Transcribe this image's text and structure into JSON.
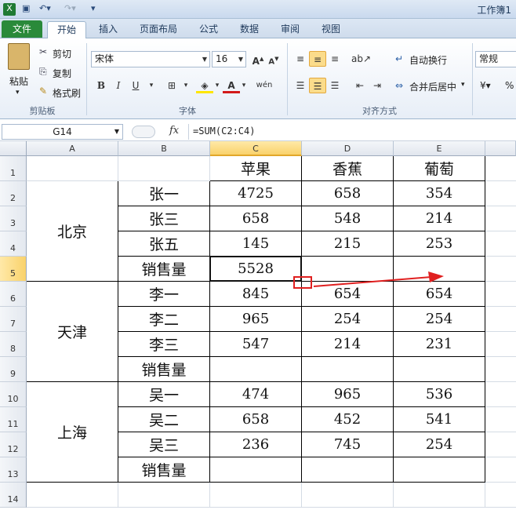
{
  "window": {
    "title": "工作簿1"
  },
  "ribbon": {
    "tabs": [
      "文件",
      "开始",
      "插入",
      "页面布局",
      "公式",
      "数据",
      "审阅",
      "视图"
    ],
    "clipboard": {
      "paste": "粘贴",
      "cut": "剪切",
      "copy": "复制",
      "format_painter": "格式刷",
      "label": "剪贴板"
    },
    "font": {
      "name": "宋体",
      "size": "16",
      "bold": "B",
      "italic": "I",
      "underline": "U",
      "label": "字体"
    },
    "alignment": {
      "wrap": "自动换行",
      "merge": "合并后居中",
      "label": "对齐方式"
    },
    "number": {
      "format": "常规",
      "percent": "%"
    }
  },
  "formula_bar": {
    "name_box": "G14",
    "fx": "fx",
    "formula": "=SUM(C2:C4)"
  },
  "columns": [
    "A",
    "B",
    "C",
    "D",
    "E"
  ],
  "rows": [
    "1",
    "2",
    "3",
    "4",
    "5",
    "6",
    "7",
    "8",
    "9",
    "10",
    "11",
    "12",
    "13",
    "14"
  ],
  "table": {
    "headers": [
      "苹果",
      "香蕉",
      "葡萄"
    ],
    "groups": [
      {
        "city": "北京",
        "rows": [
          {
            "name": "张一",
            "values": [
              "4725",
              "658",
              "354"
            ]
          },
          {
            "name": "张三",
            "values": [
              "658",
              "548",
              "214"
            ]
          },
          {
            "name": "张五",
            "values": [
              "145",
              "215",
              "253"
            ]
          },
          {
            "name": "销售量",
            "values": [
              "5528",
              "",
              ""
            ]
          }
        ]
      },
      {
        "city": "天津",
        "rows": [
          {
            "name": "李一",
            "values": [
              "845",
              "654",
              "654"
            ]
          },
          {
            "name": "李二",
            "values": [
              "965",
              "254",
              "254"
            ]
          },
          {
            "name": "李三",
            "values": [
              "547",
              "214",
              "231"
            ]
          },
          {
            "name": "销售量",
            "values": [
              "",
              "",
              ""
            ]
          }
        ]
      },
      {
        "city": "上海",
        "rows": [
          {
            "name": "吴一",
            "values": [
              "474",
              "965",
              "536"
            ]
          },
          {
            "name": "吴二",
            "values": [
              "658",
              "452",
              "541"
            ]
          },
          {
            "name": "吴三",
            "values": [
              "236",
              "745",
              "254"
            ]
          },
          {
            "name": "销售量",
            "values": [
              "",
              "",
              ""
            ]
          }
        ]
      }
    ]
  },
  "annotation": {
    "color": "#e02020"
  }
}
